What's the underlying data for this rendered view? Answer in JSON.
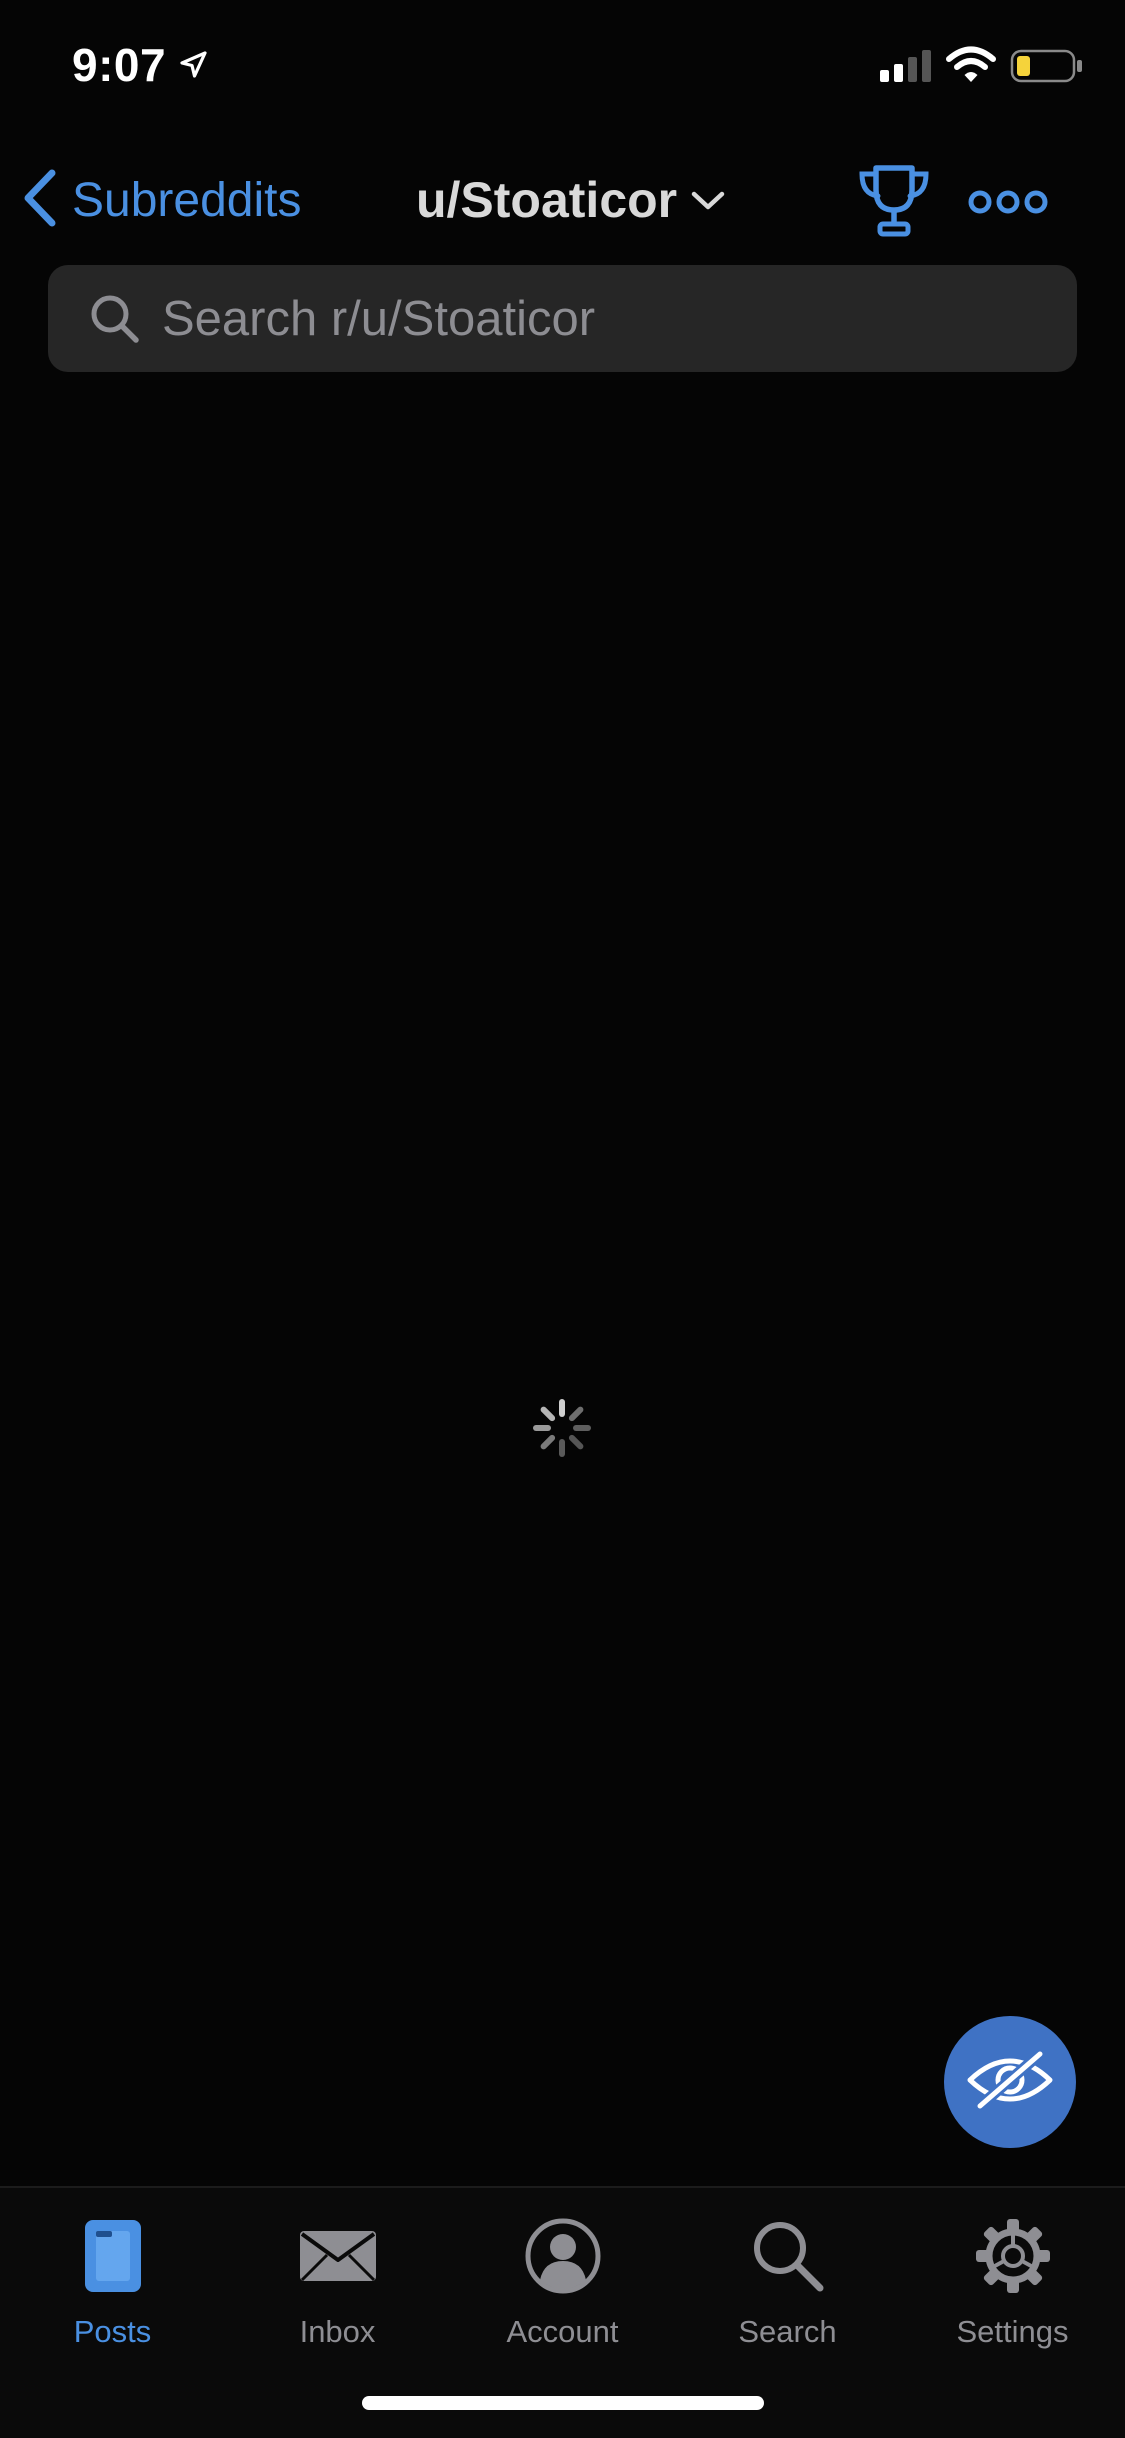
{
  "status_bar": {
    "time": "9:07",
    "battery_color": "#f5d33b"
  },
  "nav": {
    "back_label": "Subreddits",
    "title": "u/Stoaticor"
  },
  "search": {
    "placeholder": "Search r/u/Stoaticor",
    "value": ""
  },
  "tabs": [
    {
      "label": "Posts",
      "icon": "posts-icon",
      "active": true
    },
    {
      "label": "Inbox",
      "icon": "envelope-icon",
      "active": false
    },
    {
      "label": "Account",
      "icon": "account-icon",
      "active": false
    },
    {
      "label": "Search",
      "icon": "search-icon",
      "active": false
    },
    {
      "label": "Settings",
      "icon": "gear-icon",
      "active": false
    }
  ],
  "colors": {
    "accent": "#4a90e2",
    "background": "#050505",
    "fab": "#3f72c4",
    "inactive": "#8e8e93"
  }
}
